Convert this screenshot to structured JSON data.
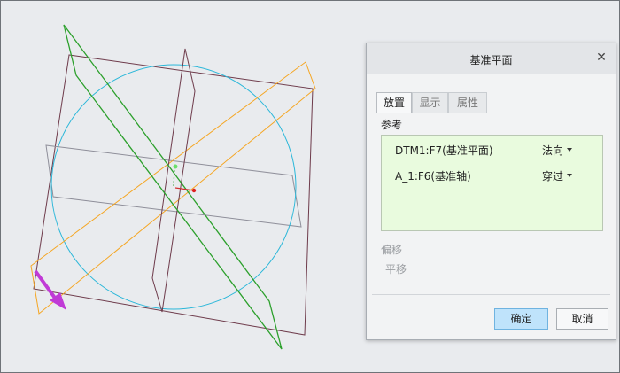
{
  "dialog": {
    "title": "基准平面",
    "tabs": [
      {
        "label": "放置",
        "active": true
      },
      {
        "label": "显示",
        "active": false
      },
      {
        "label": "属性",
        "active": false
      }
    ],
    "references_label": "参考",
    "references": [
      {
        "name": "DTM1:F7(基准平面)",
        "constraint": "法向"
      },
      {
        "name": "A_1:F6(基准轴)",
        "constraint": "穿过"
      }
    ],
    "offset_label": "偏移",
    "offset_translate_label": "平移",
    "ok_label": "确定",
    "cancel_label": "取消"
  },
  "colors": {
    "reference_list_bg": "#e9fbde",
    "ok_button_bg": "#bfe3fb",
    "sketch_circle": "#2bb7d9",
    "datum_plane_green": "#2ca02c",
    "datum_plane_orange": "#f5a623",
    "datum_plane_maroon": "#6e3b4b",
    "direction_arrow": "#c03ad6"
  }
}
